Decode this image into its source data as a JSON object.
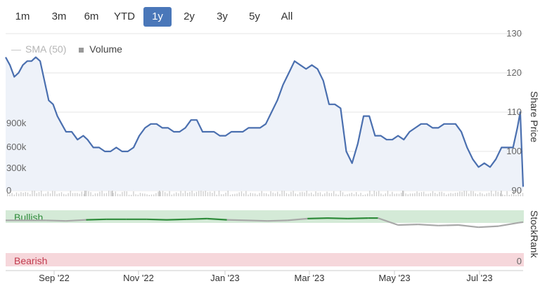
{
  "range_selector": {
    "buttons": [
      {
        "label": "1m",
        "active": false
      },
      {
        "label": "3m",
        "active": false
      },
      {
        "label": "6m",
        "active": false
      },
      {
        "label": "YTD",
        "active": false
      },
      {
        "label": "1y",
        "active": true
      },
      {
        "label": "2y",
        "active": false
      },
      {
        "label": "3y",
        "active": false
      },
      {
        "label": "5y",
        "active": false
      },
      {
        "label": "All",
        "active": false
      }
    ]
  },
  "legend": {
    "sma_label": "SMA (50)",
    "volume_label": "Volume"
  },
  "axes": {
    "price_title": "Share Price",
    "stockrank_title": "StockRank"
  },
  "chart_data": [
    {
      "type": "line",
      "ylabel": "Share Price",
      "ylim": [
        90,
        130
      ],
      "yticks": [
        "130",
        "120",
        "110",
        "100",
        "90"
      ],
      "volume_ticks": [
        "900k",
        "600k",
        "300k",
        "0"
      ],
      "xticks": [
        "Sep '22",
        "Nov '22",
        "Jan '23",
        "Mar '23",
        "May '23",
        "Jul '23"
      ],
      "series": [
        {
          "name": "Share Price",
          "x": [
            "2022-08-10",
            "2022-08-13",
            "2022-08-16",
            "2022-08-19",
            "2022-08-22",
            "2022-08-25",
            "2022-08-28",
            "2022-08-31",
            "2022-09-03",
            "2022-09-06",
            "2022-09-09",
            "2022-09-12",
            "2022-09-15",
            "2022-09-18",
            "2022-09-21",
            "2022-09-25",
            "2022-09-29",
            "2022-10-03",
            "2022-10-06",
            "2022-10-10",
            "2022-10-14",
            "2022-10-18",
            "2022-10-22",
            "2022-10-26",
            "2022-10-30",
            "2022-11-03",
            "2022-11-07",
            "2022-11-11",
            "2022-11-15",
            "2022-11-19",
            "2022-11-23",
            "2022-11-27",
            "2022-12-01",
            "2022-12-05",
            "2022-12-09",
            "2022-12-13",
            "2022-12-17",
            "2022-12-21",
            "2022-12-25",
            "2022-12-29",
            "2023-01-02",
            "2023-01-06",
            "2023-01-10",
            "2023-01-14",
            "2023-01-18",
            "2023-01-22",
            "2023-01-26",
            "2023-01-30",
            "2023-02-03",
            "2023-02-07",
            "2023-02-11",
            "2023-02-15",
            "2023-02-19",
            "2023-02-23",
            "2023-02-27",
            "2023-03-03",
            "2023-03-07",
            "2023-03-11",
            "2023-03-15",
            "2023-03-19",
            "2023-03-23",
            "2023-03-27",
            "2023-03-31",
            "2023-04-04",
            "2023-04-08",
            "2023-04-12",
            "2023-04-16",
            "2023-04-20",
            "2023-04-24",
            "2023-04-28",
            "2023-05-02",
            "2023-05-06",
            "2023-05-10",
            "2023-05-14",
            "2023-05-18",
            "2023-05-22",
            "2023-05-26",
            "2023-05-30",
            "2023-06-03",
            "2023-06-07",
            "2023-06-11",
            "2023-06-15",
            "2023-06-19",
            "2023-06-23",
            "2023-06-27",
            "2023-07-01",
            "2023-07-05",
            "2023-07-09",
            "2023-07-13",
            "2023-07-17",
            "2023-07-21",
            "2023-07-25",
            "2023-07-29",
            "2023-08-01",
            "2023-08-03",
            "2023-08-05"
          ],
          "values": [
            124,
            122,
            119,
            120,
            122,
            123,
            123,
            124,
            123,
            118,
            113,
            112,
            109,
            107,
            105,
            105,
            103,
            104,
            103,
            101,
            101,
            100,
            100,
            101,
            100,
            100,
            101,
            104,
            106,
            107,
            107,
            106,
            106,
            105,
            105,
            106,
            108,
            108,
            105,
            105,
            105,
            104,
            104,
            105,
            105,
            105,
            106,
            106,
            106,
            107,
            110,
            113,
            117,
            120,
            123,
            122,
            121,
            122,
            121,
            118,
            112,
            112,
            111,
            100,
            97,
            102,
            109,
            109,
            104,
            104,
            103,
            103,
            104,
            103,
            105,
            106,
            107,
            107,
            106,
            106,
            107,
            107,
            107,
            105,
            101,
            98,
            96,
            97,
            96,
            98,
            101,
            101,
            101,
            106,
            110,
            91
          ]
        }
      ]
    },
    {
      "type": "bar",
      "ylabel": "Volume",
      "ylim": [
        0,
        1000000
      ],
      "note_values": "daily volume"
    },
    {
      "type": "line",
      "ylabel": "StockRank",
      "labels": {
        "top": "Bullish",
        "bottom": "Bearish"
      },
      "yticks": [
        "0"
      ],
      "ylim": [
        0,
        100
      ],
      "series": [
        {
          "name": "StockRank",
          "x": [
            "2022-08-10",
            "2022-08-24",
            "2022-09-07",
            "2022-09-21",
            "2022-10-05",
            "2022-10-19",
            "2022-11-02",
            "2022-11-16",
            "2022-11-30",
            "2022-12-14",
            "2022-12-28",
            "2023-01-11",
            "2023-01-25",
            "2023-02-08",
            "2023-02-22",
            "2023-03-08",
            "2023-03-22",
            "2023-04-05",
            "2023-04-19",
            "2023-04-26",
            "2023-05-10",
            "2023-05-24",
            "2023-06-07",
            "2023-06-21",
            "2023-07-05",
            "2023-07-19",
            "2023-08-02",
            "2023-08-05"
          ],
          "values": [
            80,
            80,
            80,
            79,
            81,
            82,
            82,
            82,
            81,
            82,
            83,
            81,
            80,
            79,
            80,
            83,
            84,
            83,
            84,
            84,
            72,
            73,
            71,
            72,
            68,
            70,
            76,
            77
          ]
        }
      ]
    }
  ]
}
